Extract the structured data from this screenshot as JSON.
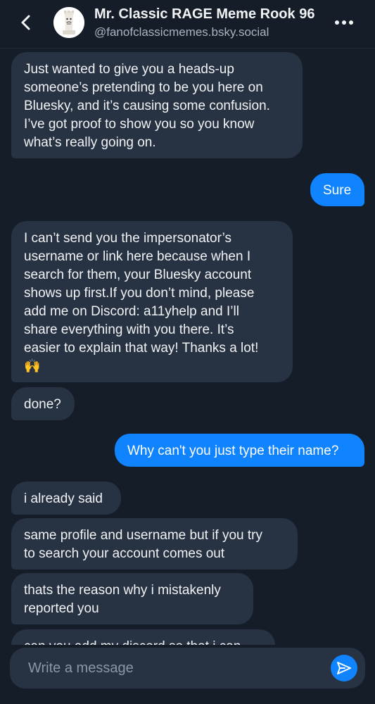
{
  "header": {
    "title": "Mr. Classic RAGE Meme Rook 96",
    "handle": "@fanofclassicmemes.bsky.social",
    "back_icon": "chevron-left-icon",
    "more_icon": "more-horizontal-icon"
  },
  "messages": [
    {
      "from": "them",
      "text": "Just wanted to give you a heads-up\nsomeone’s pretending to be you here on\nBluesky, and it’s causing some confusion.\nI’ve got proof to show you so you know\nwhat’s really going on."
    },
    {
      "from": "me",
      "text": "Sure"
    },
    {
      "from": "them",
      "text": "I can’t send you the impersonator’s\nusername or link here because when I\nsearch for them, your Bluesky account\nshows up first.If you don’t mind, please\nadd me on Discord: a11yhelp and I’ll\nshare everything with you there. It’s\neasier to explain that way! Thanks a lot!\n🙌"
    },
    {
      "from": "them",
      "text": "done?"
    },
    {
      "from": "me",
      "text": "Why can't you just type their name?"
    },
    {
      "from": "them",
      "text": "i already said"
    },
    {
      "from": "them",
      "text": "same profile and username but if you try\nto search your account comes out"
    },
    {
      "from": "them",
      "text": "thats the reason why i mistakenly\nreported you"
    },
    {
      "from": "them",
      "text": "can you add my discord so that i can"
    }
  ],
  "composer": {
    "placeholder": "Write a message",
    "send_icon": "send-icon"
  },
  "colors": {
    "background": "#151d28",
    "incoming_bubble": "#273242",
    "outgoing_bubble": "#1083fe",
    "muted_text": "#a9b3c1"
  }
}
